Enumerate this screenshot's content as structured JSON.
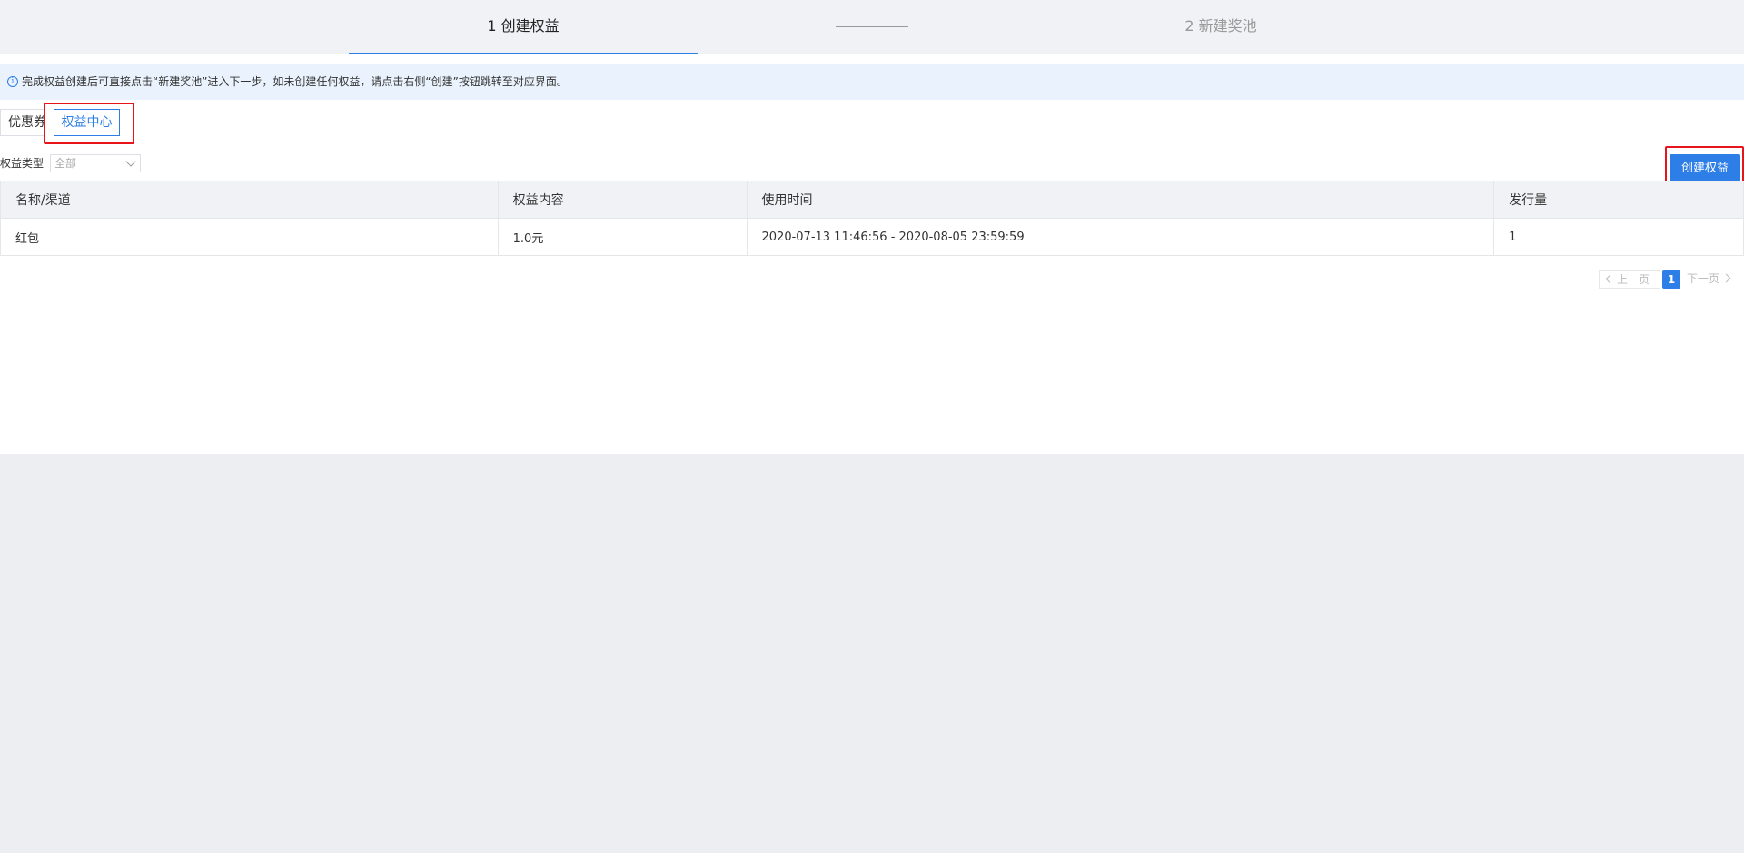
{
  "steps": {
    "step1": "1 创建权益",
    "step2": "2 新建奖池"
  },
  "notice": {
    "text": "完成权益创建后可直接点击“新建奖池”进入下一步，如未创建任何权益，请点击右侧“创建”按钮跳转至对应界面。"
  },
  "tabs": [
    {
      "label": "优惠券"
    },
    {
      "label": "权益中心"
    }
  ],
  "filter": {
    "label": "权益类型",
    "selected": "全部"
  },
  "toolbar": {
    "create_label": "创建权益"
  },
  "table": {
    "columns": [
      "名称/渠道",
      "权益内容",
      "使用时间",
      "发行量"
    ],
    "rows": [
      [
        "红包",
        "1.0元",
        "2020-07-13 11:46:56 - 2020-08-05 23:59:59",
        "1"
      ]
    ]
  },
  "pagination": {
    "prev_label": "上一页",
    "current_page": "1",
    "next_label": "下一页"
  },
  "colors": {
    "accent": "#2d7ee6",
    "highlight": "#e8141b"
  }
}
